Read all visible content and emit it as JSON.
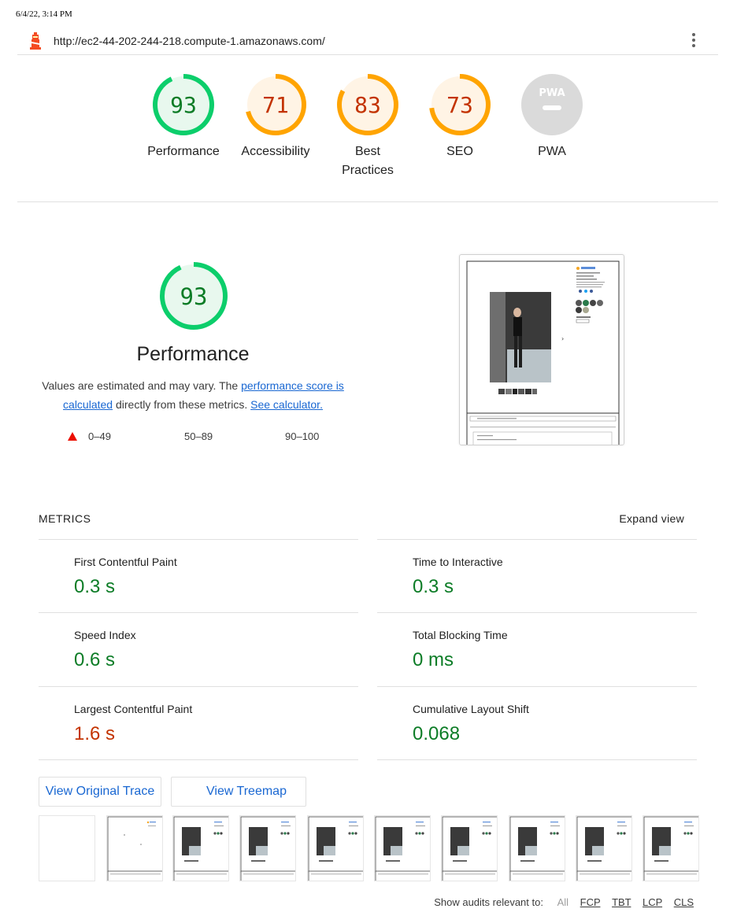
{
  "print_date": "6/4/22, 3:14 PM",
  "url": "http://ec2-44-202-244-218.compute-1.amazonaws.com/",
  "colors": {
    "pass": "#0c7c26",
    "average": "#c33300",
    "fail": "#eb0f00",
    "pass_ring": "#0cce6b",
    "average_ring": "#ffa400",
    "link": "#1967d2"
  },
  "categories": [
    {
      "score": "93",
      "label": "Performance",
      "fraction": 0.93,
      "status": "pass"
    },
    {
      "score": "71",
      "label": "Accessibility",
      "fraction": 0.71,
      "status": "average"
    },
    {
      "label_line1": "Best",
      "label_line2": "Practices",
      "score": "83",
      "fraction": 0.83,
      "status": "average"
    },
    {
      "score": "73",
      "label": "SEO",
      "fraction": 0.73,
      "status": "average"
    },
    {
      "badge": "PWA",
      "label": "PWA",
      "status": "na"
    }
  ],
  "performance": {
    "score": "93",
    "title": "Performance",
    "desc_pre": "Values are estimated and may vary. The ",
    "desc_link1": "performance score is calculated",
    "desc_mid": " directly from these metrics. ",
    "desc_link2": "See calculator.",
    "scale": [
      "0–49",
      "50–89",
      "90–100"
    ]
  },
  "metrics_header": "METRICS",
  "expand_view": "Expand view",
  "metrics": [
    {
      "label": "First Contentful Paint",
      "value": "0.3 s",
      "status": "pass"
    },
    {
      "label": "Time to Interactive",
      "value": "0.3 s",
      "status": "pass"
    },
    {
      "label": "Speed Index",
      "value": "0.6 s",
      "status": "pass"
    },
    {
      "label": "Total Blocking Time",
      "value": "0 ms",
      "status": "pass"
    },
    {
      "label": "Largest Contentful Paint",
      "value": "1.6 s",
      "status": "average"
    },
    {
      "label": "Cumulative Layout Shift",
      "value": "0.068",
      "status": "pass"
    }
  ],
  "buttons": {
    "trace": "View Original Trace",
    "treemap": "View Treemap"
  },
  "audit_filter": {
    "label": "Show audits relevant to:",
    "options": [
      "All",
      "FCP",
      "TBT",
      "LCP",
      "CLS"
    ]
  }
}
